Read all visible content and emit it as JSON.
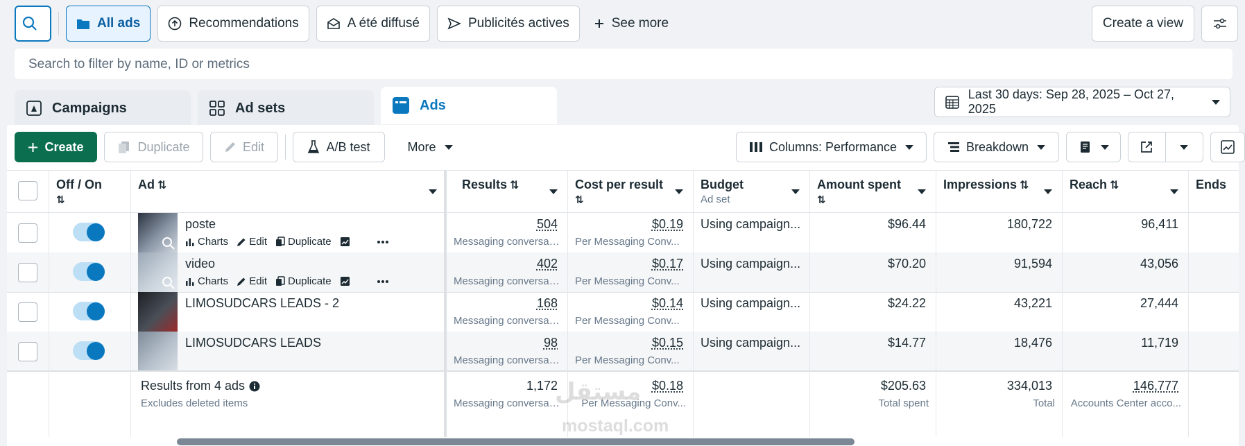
{
  "topbar": {
    "all_ads": "All ads",
    "recommendations": "Recommendations",
    "diffused": "A été diffusé",
    "active_ads": "Publicités actives",
    "see_more": "See more",
    "create_view": "Create a view"
  },
  "search": {
    "placeholder": "Search to filter by name, ID or metrics"
  },
  "tabs": {
    "campaigns": "Campaigns",
    "ad_sets": "Ad sets",
    "ads": "Ads"
  },
  "date_range": "Last 30 days: Sep 28, 2025 – Oct 27, 2025",
  "toolbar": {
    "create": "Create",
    "duplicate": "Duplicate",
    "edit": "Edit",
    "ab_test": "A/B test",
    "more": "More",
    "columns": "Columns: Performance",
    "breakdown": "Breakdown"
  },
  "columns": {
    "off_on": "Off / On",
    "ad": "Ad",
    "results": "Results",
    "cost_per_result": "Cost per result",
    "budget": "Budget",
    "budget_sub": "Ad set",
    "amount_spent": "Amount spent",
    "impressions": "Impressions",
    "reach": "Reach",
    "ends": "Ends"
  },
  "row_actions": {
    "charts": "Charts",
    "edit": "Edit",
    "duplicate": "Duplicate"
  },
  "rows": [
    {
      "name": "poste",
      "results": "504",
      "results_sub": "Messaging conversat...",
      "cpr": "$0.19",
      "cpr_sub": "Per Messaging Conv...",
      "budget": "Using campaign...",
      "spent": "$96.44",
      "impressions": "180,722",
      "reach": "96,411"
    },
    {
      "name": "video",
      "results": "402",
      "results_sub": "Messaging conversat...",
      "cpr": "$0.17",
      "cpr_sub": "Per Messaging Conv...",
      "budget": "Using campaign...",
      "spent": "$70.20",
      "impressions": "91,594",
      "reach": "43,056"
    },
    {
      "name": "LIMOSUDCARS LEADS - 2",
      "results": "168",
      "results_sub": "Messaging conversat...",
      "cpr": "$0.14",
      "cpr_sub": "Per Messaging Conv...",
      "budget": "Using campaign...",
      "spent": "$24.22",
      "impressions": "43,221",
      "reach": "27,444"
    },
    {
      "name": "LIMOSUDCARS LEADS",
      "results": "98",
      "results_sub": "Messaging conversat...",
      "cpr": "$0.15",
      "cpr_sub": "Per Messaging Conv...",
      "budget": "Using campaign...",
      "spent": "$14.77",
      "impressions": "18,476",
      "reach": "11,719"
    }
  ],
  "totals": {
    "label": "Results from 4 ads",
    "sub": "Excludes deleted items",
    "results": "1,172",
    "results_sub": "Messaging conversat...",
    "cpr": "$0.18",
    "cpr_sub": "Per Messaging Conv...",
    "spent": "$205.63",
    "spent_sub": "Total spent",
    "impressions": "334,013",
    "impressions_sub": "Total",
    "reach": "146,777",
    "reach_sub": "Accounts Center acco..."
  },
  "watermark": {
    "arabic": "مستقل",
    "latin": "mostaql.com"
  },
  "colors": {
    "accent": "#0a78be",
    "create_green": "#0b6e4f",
    "toggle_on": "#0a78be"
  }
}
